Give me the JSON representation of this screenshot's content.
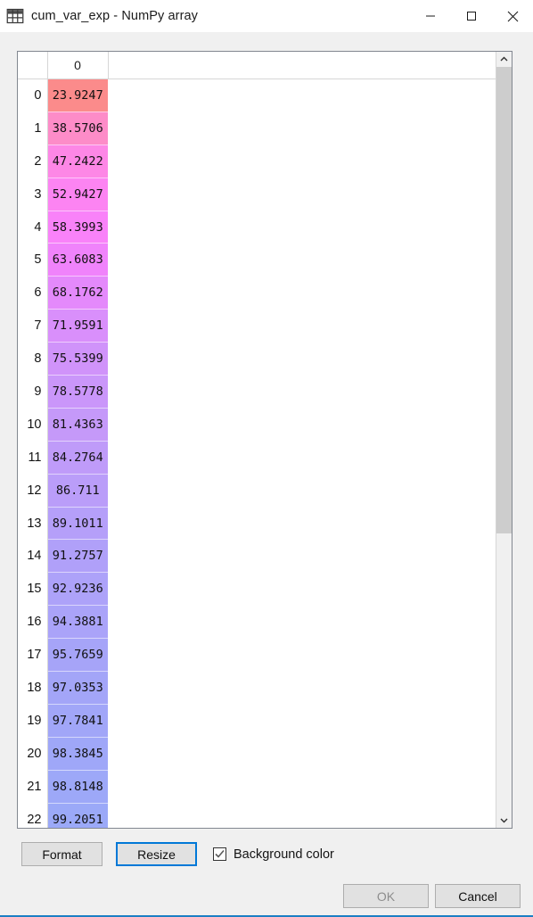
{
  "window": {
    "title": "cum_var_exp - NumPy array",
    "icon": "table-grid-icon",
    "accent_color": "#1c7fc4",
    "caption": {
      "minimize_label": "Minimize",
      "maximize_label": "Maximize",
      "close_label": "Close"
    }
  },
  "table": {
    "corner_header": "",
    "columns": [
      "0"
    ],
    "rows": [
      {
        "index": "0",
        "value": "23.9247",
        "color": "#fb8b8b"
      },
      {
        "index": "1",
        "value": "38.5706",
        "color": "#fd8cc8"
      },
      {
        "index": "2",
        "value": "47.2422",
        "color": "#fd87e6"
      },
      {
        "index": "3",
        "value": "52.9427",
        "color": "#fc84f2"
      },
      {
        "index": "4",
        "value": "58.3993",
        "color": "#f982f9"
      },
      {
        "index": "5",
        "value": "63.6083",
        "color": "#f083fb"
      },
      {
        "index": "6",
        "value": "68.1762",
        "color": "#e489fb"
      },
      {
        "index": "7",
        "value": "71.9591",
        "color": "#d98ffb"
      },
      {
        "index": "8",
        "value": "75.5399",
        "color": "#d093fa"
      },
      {
        "index": "9",
        "value": "78.5778",
        "color": "#ca96fa"
      },
      {
        "index": "10",
        "value": "81.4363",
        "color": "#c599f9"
      },
      {
        "index": "11",
        "value": "84.2764",
        "color": "#bf9bf9"
      },
      {
        "index": "12",
        "value": "86.711",
        "color": "#ba9df9"
      },
      {
        "index": "13",
        "value": "89.1011",
        "color": "#b59ff9"
      },
      {
        "index": "14",
        "value": "91.2757",
        "color": "#b0a0f9"
      },
      {
        "index": "15",
        "value": "92.9236",
        "color": "#ada2f9"
      },
      {
        "index": "16",
        "value": "94.3881",
        "color": "#aaa3f9"
      },
      {
        "index": "17",
        "value": "95.7659",
        "color": "#a6a4f8"
      },
      {
        "index": "18",
        "value": "97.0353",
        "color": "#a3a5f8"
      },
      {
        "index": "19",
        "value": "97.7841",
        "color": "#a1a6f8"
      },
      {
        "index": "20",
        "value": "98.3845",
        "color": "#9fa7f8"
      },
      {
        "index": "21",
        "value": "98.8148",
        "color": "#9da8f8"
      },
      {
        "index": "22",
        "value": "99.2051",
        "color": "#9ba9f8"
      }
    ]
  },
  "scrollbar": {
    "up_arrow": "chevron-up-icon",
    "down_arrow": "chevron-down-icon",
    "thumb_fraction": "62.5"
  },
  "controls": {
    "format_label": "Format",
    "resize_label": "Resize",
    "background_color_label": "Background color",
    "background_color_checked": true,
    "focus_color": "#0078d7"
  },
  "dialog": {
    "ok_label": "OK",
    "cancel_label": "Cancel"
  }
}
